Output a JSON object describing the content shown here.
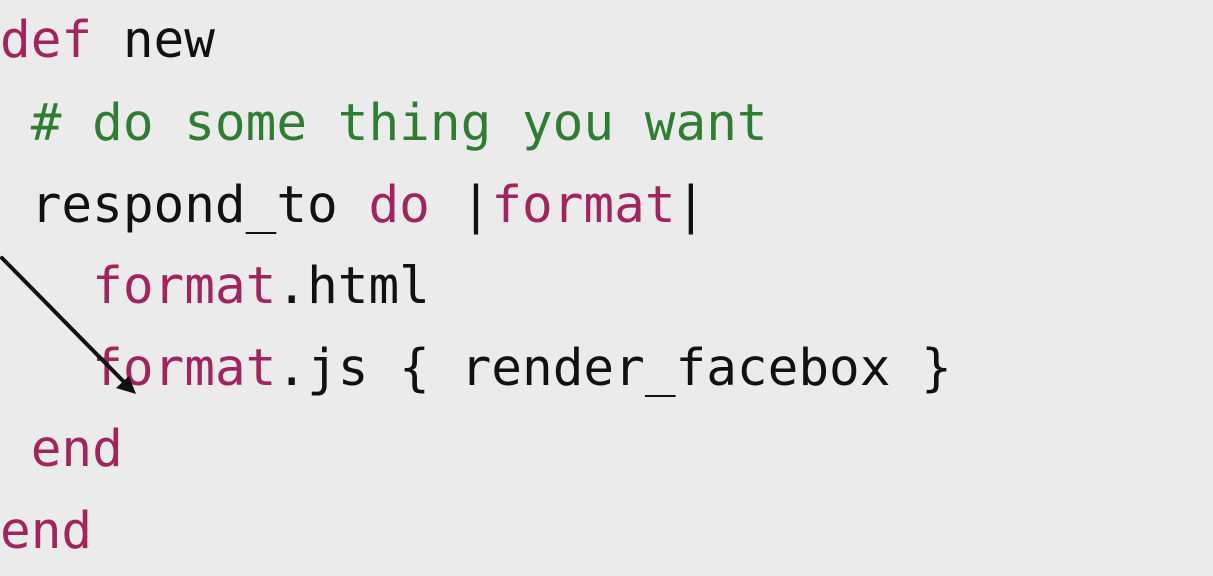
{
  "code": {
    "lines": [
      [
        {
          "text": "def",
          "style": "kw"
        },
        {
          "text": " new",
          "style": "plain"
        }
      ],
      [
        {
          "text": " # do some thing you want",
          "style": "cm"
        }
      ],
      [
        {
          "text": " respond_to ",
          "style": "plain"
        },
        {
          "text": "do",
          "style": "kw"
        },
        {
          "text": " |",
          "style": "plain"
        },
        {
          "text": "format",
          "style": "kw"
        },
        {
          "text": "|",
          "style": "plain"
        }
      ],
      [
        {
          "text": "   ",
          "style": "plain"
        },
        {
          "text": "format",
          "style": "kw"
        },
        {
          "text": ".html",
          "style": "plain"
        }
      ],
      [
        {
          "text": "   ",
          "style": "plain"
        },
        {
          "text": "format",
          "style": "kw"
        },
        {
          "text": ".js { render_facebox }",
          "style": "plain"
        }
      ],
      [
        {
          "text": " ",
          "style": "plain"
        },
        {
          "text": "end",
          "style": "kw"
        }
      ],
      [
        {
          "text": "end",
          "style": "kw"
        }
      ]
    ]
  },
  "colors": {
    "keyword": "#a0245e",
    "comment": "#2e7d32",
    "text": "#111111",
    "background": "#ebebeb"
  },
  "annotation": {
    "icon": "arrow-icon"
  }
}
